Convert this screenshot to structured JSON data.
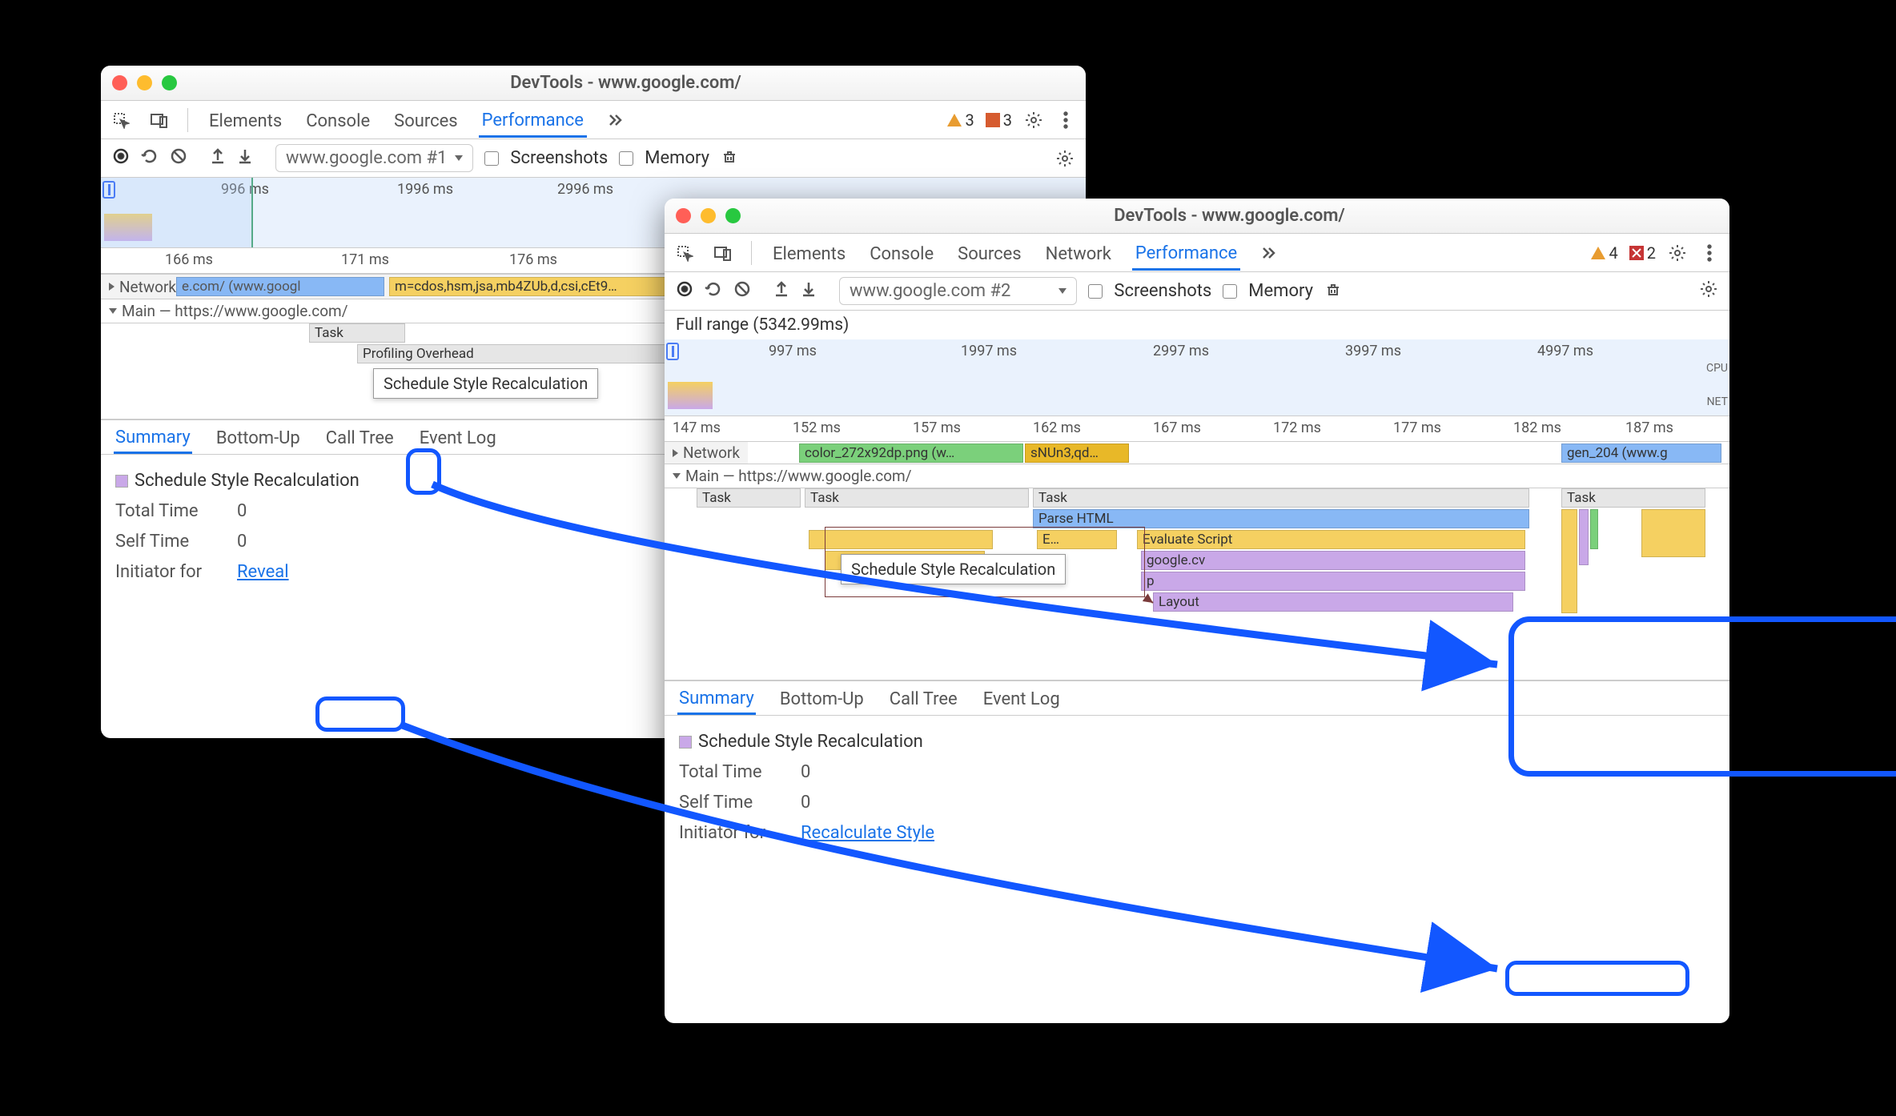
{
  "win1": {
    "title": "DevTools - www.google.com/",
    "tabs": [
      "Elements",
      "Console",
      "Sources",
      "Performance"
    ],
    "active_tab": "Performance",
    "warn_badge": "3",
    "err_badge": "3",
    "target": "www.google.com #1",
    "chk_screenshots": "Screenshots",
    "chk_memory": "Memory",
    "overview_ticks": [
      "996 ms",
      "1996 ms",
      "2996 ms"
    ],
    "ruler_ticks": [
      "166 ms",
      "171 ms",
      "176 ms"
    ],
    "network_label": "Network",
    "network_item1": "e.com/ (www.googl",
    "network_item2": "m=cdos,hsm,jsa,mb4ZUb,d,csi,cEt9…",
    "main_label": "Main — https://www.google.com/",
    "flame_task": "Task",
    "flame_overhead": "Profiling Overhead",
    "tooltip": "Schedule Style Recalculation",
    "panel_tabs": [
      "Summary",
      "Bottom-Up",
      "Call Tree",
      "Event Log"
    ],
    "summary_title": "Schedule Style Recalculation",
    "total_time_k": "Total Time",
    "total_time_v": "0",
    "self_time_k": "Self Time",
    "self_time_v": "0",
    "initiator_k": "Initiator for",
    "initiator_link": "Reveal"
  },
  "win2": {
    "title": "DevTools - www.google.com/",
    "tabs": [
      "Elements",
      "Console",
      "Sources",
      "Network",
      "Performance"
    ],
    "active_tab": "Performance",
    "warn_badge": "4",
    "err_badge": "2",
    "target": "www.google.com #2",
    "chk_screenshots": "Screenshots",
    "chk_memory": "Memory",
    "range": "Full range (5342.99ms)",
    "overview_ticks": [
      "997 ms",
      "1997 ms",
      "2997 ms",
      "3997 ms",
      "4997 ms"
    ],
    "overview_cpu": "CPU",
    "overview_net": "NET",
    "ruler_ticks": [
      "147 ms",
      "152 ms",
      "157 ms",
      "162 ms",
      "167 ms",
      "172 ms",
      "177 ms",
      "182 ms",
      "187 ms"
    ],
    "network_label": "Network",
    "net_item1": "color_272x92dp.png (w…",
    "net_item2": "sNUn3,qd…",
    "net_item3": "gen_204 (www.g",
    "main_label": "Main — https://www.google.com/",
    "task": "Task",
    "parse_html": "Parse HTML",
    "e_label": "E…",
    "eval": "Evaluate Script",
    "google_cv": "google.cv",
    "p": "p",
    "layout": "Layout",
    "tooltip": "Schedule Style Recalculation",
    "panel_tabs": [
      "Summary",
      "Bottom-Up",
      "Call Tree",
      "Event Log"
    ],
    "summary_title": "Schedule Style Recalculation",
    "total_time_k": "Total Time",
    "total_time_v": "0",
    "self_time_k": "Self Time",
    "self_time_v": "0",
    "initiator_k": "Initiator for",
    "initiator_link": "Recalculate Style"
  }
}
